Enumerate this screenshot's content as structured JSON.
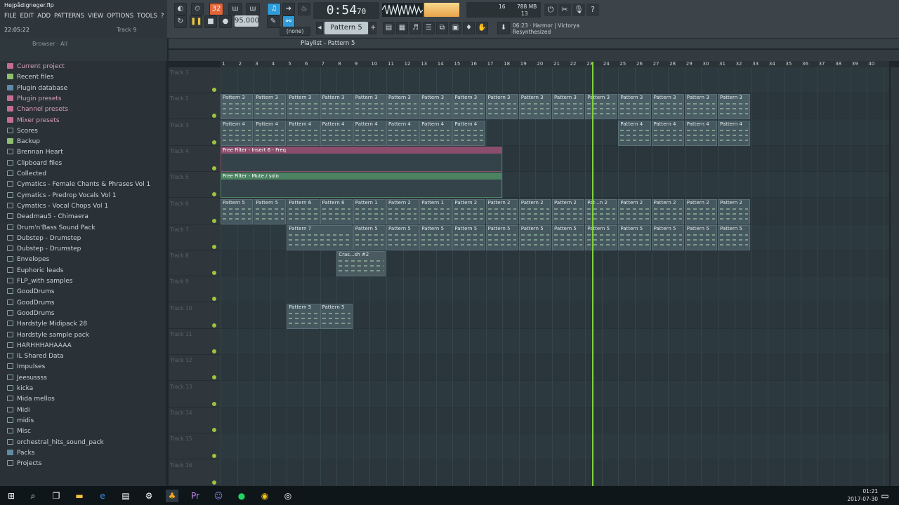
{
  "window": {
    "file_title": "Hejpådigneger.flp",
    "hint_time": "22:05:22",
    "hint_track": "Track 9"
  },
  "menu": [
    "FILE",
    "EDIT",
    "ADD",
    "PATTERNS",
    "VIEW",
    "OPTIONS",
    "TOOLS",
    "?"
  ],
  "transport": {
    "time": "0:54",
    "time_small": "70",
    "tempo": "95.000",
    "pattern": "Pattern 5",
    "snap": "(none)",
    "rec_badge": "32"
  },
  "cpu": {
    "line1": "16",
    "mem": "788 MB",
    "line2": "13"
  },
  "hint_panel": {
    "line1": "06:23 · Harmor | Victorya",
    "line2": "Resynthesized"
  },
  "browser": {
    "title": "Browser · All",
    "items": [
      {
        "label": "Current project",
        "style": "pink"
      },
      {
        "label": "Recent files",
        "style": "green"
      },
      {
        "label": "Plugin database",
        "style": "blue"
      },
      {
        "label": "Plugin presets",
        "style": "pink"
      },
      {
        "label": "Channel presets",
        "style": "pink"
      },
      {
        "label": "Mixer presets",
        "style": "pink"
      },
      {
        "label": "Scores",
        "style": "plain"
      },
      {
        "label": "Backup",
        "style": "green"
      },
      {
        "label": "Brennan Heart",
        "style": "plain"
      },
      {
        "label": "Clipboard files",
        "style": "plain"
      },
      {
        "label": "Collected",
        "style": "plain"
      },
      {
        "label": "Cymatics - Female Chants & Phrases Vol 1",
        "style": "plain"
      },
      {
        "label": "Cymatics - Predrop Vocals Vol 1",
        "style": "plain"
      },
      {
        "label": "Cymatics - Vocal Chops Vol 1",
        "style": "plain"
      },
      {
        "label": "Deadmau5 - Chimaera",
        "style": "plain"
      },
      {
        "label": "Drum'n'Bass Sound Pack",
        "style": "plain"
      },
      {
        "label": "Dubstep - Drumstep",
        "style": "plain"
      },
      {
        "label": "Dubstep - Drumstep",
        "style": "plain"
      },
      {
        "label": "Envelopes",
        "style": "plain"
      },
      {
        "label": "Euphoric leads",
        "style": "plain"
      },
      {
        "label": "FLP_with samples",
        "style": "plain"
      },
      {
        "label": "GoodDrums",
        "style": "plain"
      },
      {
        "label": "GoodDrums",
        "style": "plain"
      },
      {
        "label": "GoodDrums",
        "style": "plain"
      },
      {
        "label": "Hardstyle Midipack 28",
        "style": "plain"
      },
      {
        "label": "Hardstyle sample pack",
        "style": "plain"
      },
      {
        "label": "HARHHHAHAAAA",
        "style": "plain"
      },
      {
        "label": "IL Shared Data",
        "style": "plain"
      },
      {
        "label": "Impulses",
        "style": "plain"
      },
      {
        "label": "Jeesussss",
        "style": "plain"
      },
      {
        "label": "kicka",
        "style": "plain"
      },
      {
        "label": "Mida mellos",
        "style": "plain"
      },
      {
        "label": "Midi",
        "style": "plain"
      },
      {
        "label": "midis",
        "style": "plain"
      },
      {
        "label": "Misc",
        "style": "plain"
      },
      {
        "label": "orchestral_hits_sound_pack",
        "style": "plain"
      },
      {
        "label": "Packs",
        "style": "blue"
      },
      {
        "label": "Projects",
        "style": "plain"
      }
    ]
  },
  "playlist": {
    "title": "Playlist - Pattern 5",
    "ruler": [
      "1",
      "2",
      "3",
      "4",
      "5",
      "6",
      "7",
      "8",
      "9",
      "10",
      "11",
      "12",
      "13",
      "14",
      "15",
      "16",
      "17",
      "18",
      "19",
      "20",
      "21",
      "22",
      "23",
      "24",
      "25",
      "26",
      "27",
      "28",
      "29",
      "30",
      "31",
      "32",
      "33",
      "34",
      "35",
      "36",
      "37",
      "38",
      "39",
      "40"
    ],
    "tracks": [
      "Track 1",
      "Track 2",
      "Track 3",
      "Track 4",
      "Track 5",
      "Track 6",
      "Track 7",
      "Track 8",
      "Track 9",
      "Track 10",
      "Track 11",
      "Track 12",
      "Track 13",
      "Track 14",
      "Track 15",
      "Track 16"
    ],
    "clips": [
      {
        "track": 1,
        "start": 1,
        "len": 2,
        "label": "Pattern 3",
        "color": "#4b5e66"
      },
      {
        "track": 1,
        "start": 3,
        "len": 2,
        "label": "Pattern 3",
        "color": "#4b5e66"
      },
      {
        "track": 1,
        "start": 5,
        "len": 2,
        "label": "Pattern 3",
        "color": "#4b5e66"
      },
      {
        "track": 1,
        "start": 7,
        "len": 2,
        "label": "Pattern 3",
        "color": "#4b5e66"
      },
      {
        "track": 1,
        "start": 9,
        "len": 2,
        "label": "Pattern 3",
        "color": "#4b5e66"
      },
      {
        "track": 1,
        "start": 11,
        "len": 2,
        "label": "Pattern 3",
        "color": "#4b5e66"
      },
      {
        "track": 1,
        "start": 13,
        "len": 2,
        "label": "Pattern 3",
        "color": "#4b5e66"
      },
      {
        "track": 1,
        "start": 15,
        "len": 2,
        "label": "Pattern 3",
        "color": "#4b5e66"
      },
      {
        "track": 1,
        "start": 17,
        "len": 2,
        "label": "Pattern 3",
        "color": "#4b5e66"
      },
      {
        "track": 1,
        "start": 19,
        "len": 2,
        "label": "Pattern 3",
        "color": "#4b5e66"
      },
      {
        "track": 1,
        "start": 21,
        "len": 2,
        "label": "Pattern 3",
        "color": "#4b5e66"
      },
      {
        "track": 1,
        "start": 23,
        "len": 2,
        "label": "Pattern 3",
        "color": "#4b5e66"
      },
      {
        "track": 1,
        "start": 25,
        "len": 2,
        "label": "Pattern 3",
        "color": "#4b5e66"
      },
      {
        "track": 1,
        "start": 27,
        "len": 2,
        "label": "Pattern 3",
        "color": "#4b5e66"
      },
      {
        "track": 1,
        "start": 29,
        "len": 2,
        "label": "Pattern 3",
        "color": "#4b5e66"
      },
      {
        "track": 1,
        "start": 31,
        "len": 2,
        "label": "Pattern 3",
        "color": "#4b5e66"
      },
      {
        "track": 2,
        "start": 1,
        "len": 2,
        "label": "Pattern 4",
        "color": "#46585f"
      },
      {
        "track": 2,
        "start": 3,
        "len": 2,
        "label": "Pattern 4",
        "color": "#46585f"
      },
      {
        "track": 2,
        "start": 5,
        "len": 2,
        "label": "Pattern 4",
        "color": "#46585f"
      },
      {
        "track": 2,
        "start": 7,
        "len": 2,
        "label": "Pattern 4",
        "color": "#46585f"
      },
      {
        "track": 2,
        "start": 9,
        "len": 2,
        "label": "Pattern 4",
        "color": "#46585f"
      },
      {
        "track": 2,
        "start": 11,
        "len": 2,
        "label": "Pattern 4",
        "color": "#46585f"
      },
      {
        "track": 2,
        "start": 13,
        "len": 2,
        "label": "Pattern 4",
        "color": "#46585f"
      },
      {
        "track": 2,
        "start": 15,
        "len": 2,
        "label": "Pattern 4",
        "color": "#46585f"
      },
      {
        "track": 2,
        "start": 25,
        "len": 2,
        "label": "Pattern 4",
        "color": "#46585f"
      },
      {
        "track": 2,
        "start": 27,
        "len": 2,
        "label": "Pattern 4",
        "color": "#46585f"
      },
      {
        "track": 2,
        "start": 29,
        "len": 2,
        "label": "Pattern 4",
        "color": "#46585f"
      },
      {
        "track": 2,
        "start": 31,
        "len": 2,
        "label": "Pattern 4",
        "color": "#46585f"
      },
      {
        "track": 5,
        "start": 1,
        "len": 2,
        "label": "Pattern 5",
        "color": "#46585f"
      },
      {
        "track": 5,
        "start": 3,
        "len": 2,
        "label": "Pattern 5",
        "color": "#46585f"
      },
      {
        "track": 5,
        "start": 5,
        "len": 2,
        "label": "Pattern 6",
        "color": "#46585f"
      },
      {
        "track": 5,
        "start": 7,
        "len": 2,
        "label": "Pattern 6",
        "color": "#46585f"
      },
      {
        "track": 5,
        "start": 9,
        "len": 2,
        "label": "Pattern 1",
        "color": "#46585f"
      },
      {
        "track": 5,
        "start": 11,
        "len": 2,
        "label": "Pattern 2",
        "color": "#46585f"
      },
      {
        "track": 5,
        "start": 13,
        "len": 2,
        "label": "Pattern 1",
        "color": "#46585f"
      },
      {
        "track": 5,
        "start": 15,
        "len": 2,
        "label": "Pattern 2",
        "color": "#46585f"
      },
      {
        "track": 5,
        "start": 17,
        "len": 2,
        "label": "Pattern 2",
        "color": "#46585f"
      },
      {
        "track": 5,
        "start": 19,
        "len": 2,
        "label": "Pattern 2",
        "color": "#46585f"
      },
      {
        "track": 5,
        "start": 21,
        "len": 2,
        "label": "Pattern 2",
        "color": "#46585f"
      },
      {
        "track": 5,
        "start": 23,
        "len": 2,
        "label": "Pat...n 2",
        "color": "#46585f"
      },
      {
        "track": 5,
        "start": 25,
        "len": 2,
        "label": "Pattern 2",
        "color": "#46585f"
      },
      {
        "track": 5,
        "start": 27,
        "len": 2,
        "label": "Pattern 2",
        "color": "#46585f"
      },
      {
        "track": 5,
        "start": 29,
        "len": 2,
        "label": "Pattern 2",
        "color": "#46585f"
      },
      {
        "track": 5,
        "start": 31,
        "len": 2,
        "label": "Pattern 2",
        "color": "#46585f"
      },
      {
        "track": 6,
        "start": 5,
        "len": 4,
        "label": "Pattern 7",
        "color": "#46585f"
      },
      {
        "track": 6,
        "start": 9,
        "len": 2,
        "label": "Pattern 5",
        "color": "#46585f"
      },
      {
        "track": 6,
        "start": 11,
        "len": 2,
        "label": "Pattern 5",
        "color": "#46585f"
      },
      {
        "track": 6,
        "start": 13,
        "len": 2,
        "label": "Pattern 5",
        "color": "#46585f"
      },
      {
        "track": 6,
        "start": 15,
        "len": 2,
        "label": "Pattern 5",
        "color": "#46585f"
      },
      {
        "track": 6,
        "start": 17,
        "len": 2,
        "label": "Pattern 5",
        "color": "#46585f"
      },
      {
        "track": 6,
        "start": 19,
        "len": 2,
        "label": "Pattern 5",
        "color": "#46585f"
      },
      {
        "track": 6,
        "start": 21,
        "len": 2,
        "label": "Pattern 5",
        "color": "#46585f"
      },
      {
        "track": 6,
        "start": 23,
        "len": 2,
        "label": "Pattern 5",
        "color": "#46585f"
      },
      {
        "track": 6,
        "start": 25,
        "len": 2,
        "label": "Pattern 5",
        "color": "#46585f"
      },
      {
        "track": 6,
        "start": 27,
        "len": 2,
        "label": "Pattern 5",
        "color": "#46585f"
      },
      {
        "track": 6,
        "start": 29,
        "len": 2,
        "label": "Pattern 5",
        "color": "#46585f"
      },
      {
        "track": 6,
        "start": 31,
        "len": 2,
        "label": "Pattern 5",
        "color": "#46585f"
      },
      {
        "track": 7,
        "start": 8,
        "len": 3,
        "label": "Cras...sh #2",
        "color": "#4a5a60"
      },
      {
        "track": 9,
        "start": 5,
        "len": 2,
        "label": "Pattern 5",
        "color": "#46585f"
      },
      {
        "track": 9,
        "start": 7,
        "len": 2,
        "label": "Pattern 5",
        "color": "#46585f"
      }
    ],
    "automations": [
      {
        "track": 3,
        "start": 1,
        "len": 17,
        "label": "Free Filter - Insert 6 - Freq",
        "color": "#8a4e6c"
      },
      {
        "track": 4,
        "start": 1,
        "len": 17,
        "label": "Free Filter - Mute / solo",
        "color": "#4c8262"
      }
    ],
    "playhead_bar": 23.4
  },
  "taskbar": {
    "time": "01:21",
    "date": "2017-07-30"
  }
}
